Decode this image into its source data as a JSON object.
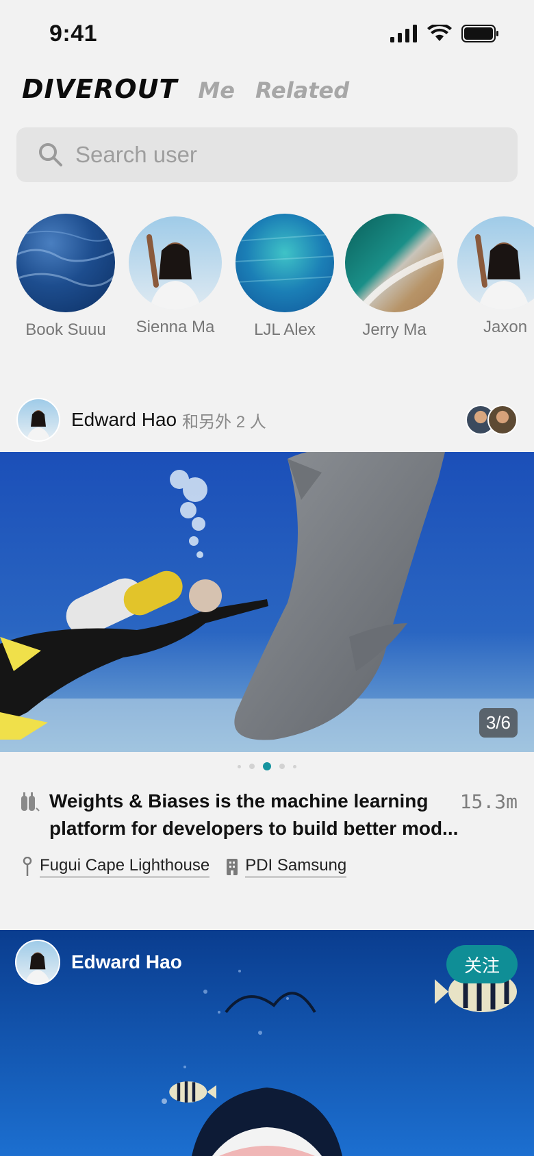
{
  "status_bar": {
    "time": "9:41"
  },
  "header": {
    "brand": "DIVEROUT",
    "tabs": [
      "Me",
      "Related"
    ]
  },
  "search": {
    "placeholder": "Search user"
  },
  "stories": [
    {
      "name": "Book Suuu"
    },
    {
      "name": "Sienna Ma"
    },
    {
      "name": "LJL Alex"
    },
    {
      "name": "Jerry Ma"
    },
    {
      "name": "Jaxon"
    }
  ],
  "post1": {
    "author": "Edward Hao",
    "others": "和另外 2 人",
    "counter": "3/6",
    "caption": "Weights & Biases is the machine learning platform for developers to build better mod...",
    "depth": "15.3m",
    "location": "Fugui Cape Lighthouse",
    "organization": "PDI Samsung",
    "active_dot_index": 2
  },
  "post2": {
    "author": "Edward Hao",
    "follow_label": "关注"
  },
  "colors": {
    "accent": "#16949f",
    "background": "#f2f2f2"
  }
}
